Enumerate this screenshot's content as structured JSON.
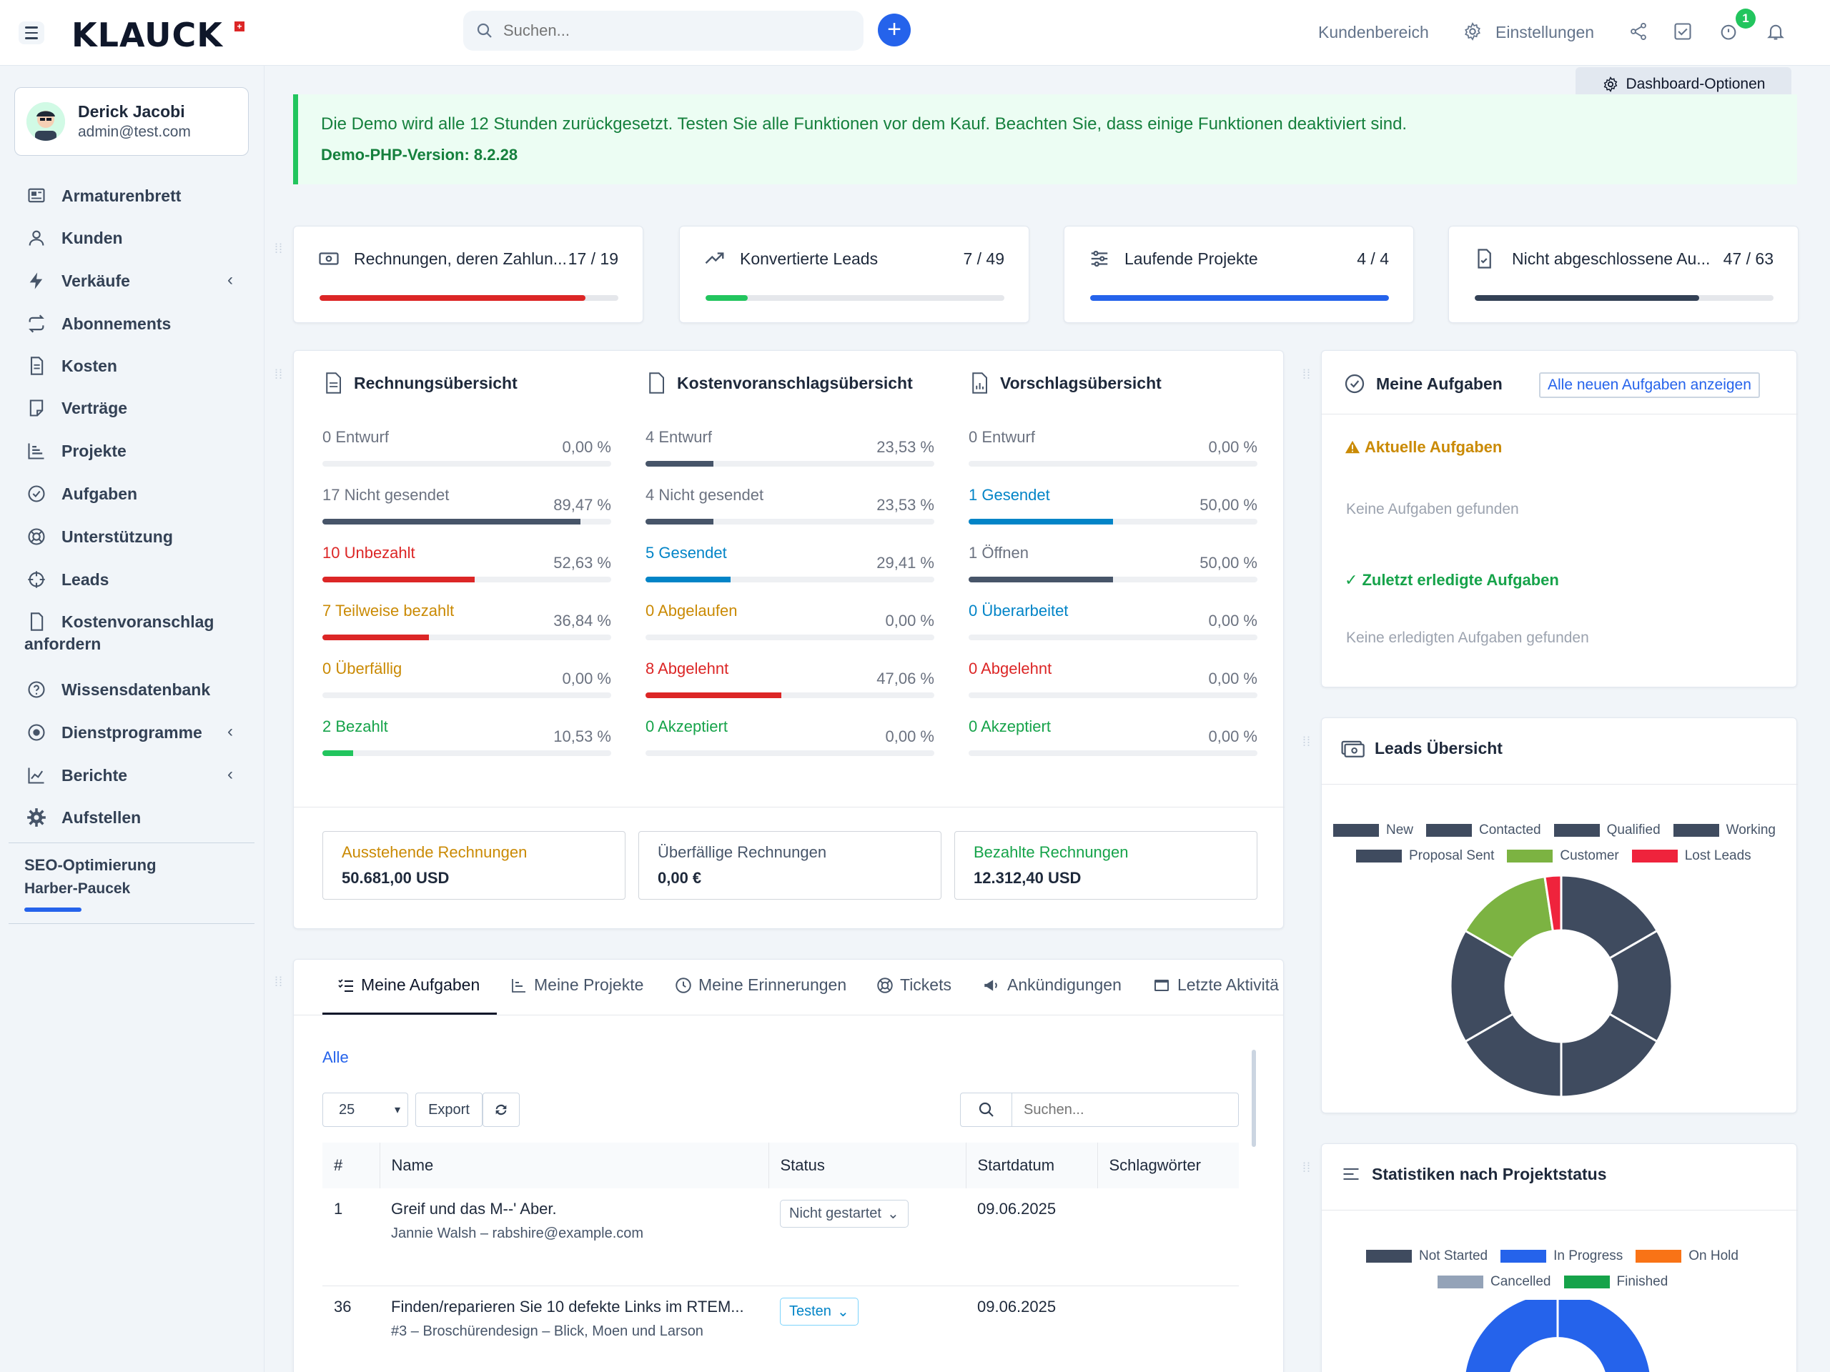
{
  "header": {
    "logo": "KLAUCK",
    "search_placeholder": "Suchen...",
    "kundenbereich": "Kundenbereich",
    "einstellungen": "Einstellungen",
    "notification_count": "1"
  },
  "user": {
    "name": "Derick Jacobi",
    "email": "admin@test.com"
  },
  "sidebar": {
    "items": [
      {
        "label": "Armaturenbrett"
      },
      {
        "label": "Kunden"
      },
      {
        "label": "Verkäufe"
      },
      {
        "label": "Abonnements"
      },
      {
        "label": "Kosten"
      },
      {
        "label": "Verträge"
      },
      {
        "label": "Projekte"
      },
      {
        "label": "Aufgaben"
      },
      {
        "label": "Unterstützung"
      },
      {
        "label": "Leads"
      },
      {
        "label": "Kostenvoranschlag"
      },
      {
        "label": "Wissensdatenbank"
      },
      {
        "label": "Dienstprogramme"
      },
      {
        "label": "Berichte"
      },
      {
        "label": "Aufstellen"
      }
    ],
    "kv_line2": "anfordern",
    "seo_title": "SEO-Optimierung",
    "seo_client": "Harber-Paucek"
  },
  "dashboard_options": "Dashboard-Optionen",
  "alert": {
    "message": "Die Demo wird alle 12 Stunden zurückgesetzt. Testen Sie alle Funktionen vor dem Kauf. Beachten Sie, dass einige Funktionen deaktiviert sind.",
    "php": "Demo-PHP-Version: 8.2.28"
  },
  "stats": [
    {
      "label": "Rechnungen, deren Zahlun...",
      "value": "17 / 19",
      "progress": 0.89,
      "color": "#dc2626"
    },
    {
      "label": "Konvertierte Leads",
      "value": "7 / 49",
      "progress": 0.14,
      "color": "#22c55e"
    },
    {
      "label": "Laufende Projekte",
      "value": "4 / 4",
      "progress": 1.0,
      "color": "#2563eb"
    },
    {
      "label": "Nicht abgeschlossene Au...",
      "value": "47 / 63",
      "progress": 0.75,
      "color": "#334155"
    }
  ],
  "overview": {
    "invoice": {
      "title": "Rechnungsübersicht",
      "rows": [
        {
          "label": "0 Entwurf",
          "pct": "0,00 %",
          "value": 0,
          "color": "#6b7280",
          "bar": "#475569"
        },
        {
          "label": "17 Nicht gesendet",
          "pct": "89,47 %",
          "value": 89.47,
          "color": "#6b7280",
          "bar": "#475569"
        },
        {
          "label": "10 Unbezahlt",
          "pct": "52,63 %",
          "value": 52.63,
          "color": "#dc2626",
          "bar": "#dc2626"
        },
        {
          "label": "7 Teilweise bezahlt",
          "pct": "36,84 %",
          "value": 36.84,
          "color": "#ca8a04",
          "bar": "#dc2626"
        },
        {
          "label": "0 Überfällig",
          "pct": "0,00 %",
          "value": 0,
          "color": "#ca8a04",
          "bar": "#ca8a04"
        },
        {
          "label": "2 Bezahlt",
          "pct": "10,53 %",
          "value": 10.53,
          "color": "#16a34a",
          "bar": "#22c55e"
        }
      ]
    },
    "estimate": {
      "title": "Kostenvoranschlagsübersicht",
      "rows": [
        {
          "label": "4 Entwurf",
          "pct": "23,53 %",
          "value": 23.53,
          "color": "#6b7280",
          "bar": "#475569"
        },
        {
          "label": "4 Nicht gesendet",
          "pct": "23,53 %",
          "value": 23.53,
          "color": "#6b7280",
          "bar": "#475569"
        },
        {
          "label": "5 Gesendet",
          "pct": "29,41 %",
          "value": 29.41,
          "color": "#0284c7",
          "bar": "#0284c7"
        },
        {
          "label": "0 Abgelaufen",
          "pct": "0,00 %",
          "value": 0,
          "color": "#ca8a04",
          "bar": "#ca8a04"
        },
        {
          "label": "8 Abgelehnt",
          "pct": "47,06 %",
          "value": 47.06,
          "color": "#dc2626",
          "bar": "#dc2626"
        },
        {
          "label": "0 Akzeptiert",
          "pct": "0,00 %",
          "value": 0,
          "color": "#16a34a",
          "bar": "#22c55e"
        }
      ]
    },
    "proposal": {
      "title": "Vorschlagsübersicht",
      "rows": [
        {
          "label": "0 Entwurf",
          "pct": "0,00 %",
          "value": 0,
          "color": "#6b7280",
          "bar": "#475569"
        },
        {
          "label": "1 Gesendet",
          "pct": "50,00 %",
          "value": 50,
          "color": "#0284c7",
          "bar": "#0284c7"
        },
        {
          "label": "1 Öffnen",
          "pct": "50,00 %",
          "value": 50,
          "color": "#6b7280",
          "bar": "#475569"
        },
        {
          "label": "0 Überarbeitet",
          "pct": "0,00 %",
          "value": 0,
          "color": "#0284c7",
          "bar": "#0284c7"
        },
        {
          "label": "0 Abgelehnt",
          "pct": "0,00 %",
          "value": 0,
          "color": "#dc2626",
          "bar": "#dc2626"
        },
        {
          "label": "0 Akzeptiert",
          "pct": "0,00 %",
          "value": 0,
          "color": "#16a34a",
          "bar": "#22c55e"
        }
      ]
    }
  },
  "summary": [
    {
      "label": "Ausstehende Rechnungen",
      "value": "50.681,00 USD",
      "color": "#ca8a04"
    },
    {
      "label": "Überfällige Rechnungen",
      "value": "0,00 €",
      "color": "#475569"
    },
    {
      "label": "Bezahlte Rechnungen",
      "value": "12.312,40 USD",
      "color": "#16a34a"
    }
  ],
  "tasks_panel": {
    "title": "Meine Aufgaben",
    "link": "Alle neuen Aufgaben anzeigen",
    "current": "Aktuelle Aufgaben",
    "none_current": "Keine Aufgaben gefunden",
    "done": "Zuletzt erledigte Aufgaben",
    "none_done": "Keine erledigten Aufgaben gefunden"
  },
  "tabs": [
    "Meine Aufgaben",
    "Meine Projekte",
    "Meine Erinnerungen",
    "Tickets",
    "Ankündigungen",
    "Letzte Aktivitä"
  ],
  "table": {
    "filter_all": "Alle",
    "page_size": "25",
    "export": "Export",
    "search_placeholder": "Suchen...",
    "headers": [
      "#",
      "Name",
      "Status",
      "Startdatum",
      "Schlagwörter"
    ],
    "rows": [
      {
        "id": "1",
        "name": "Greif und das M--' Aber.",
        "sub": "Jannie Walsh – rabshire@example.com",
        "status": "Nicht gestartet",
        "start": "09.06.2025"
      },
      {
        "id": "36",
        "name": "Finden/reparieren Sie 10 defekte Links im RTEM...",
        "sub": "#3 – Broschürendesign – Blick, Moen und Larson",
        "status": "Testen",
        "start": "09.06.2025"
      }
    ]
  },
  "leads_chart": {
    "title": "Leads Übersicht",
    "chart_data": {
      "type": "pie",
      "variant": "doughnut",
      "legend": [
        "New",
        "Contacted",
        "Qualified",
        "Working",
        "Proposal Sent",
        "Customer",
        "Lost Leads"
      ],
      "colors": [
        "#3f4b5f",
        "#3f4b5f",
        "#3f4b5f",
        "#3f4b5f",
        "#3f4b5f",
        "#7cb342",
        "#ef233c"
      ],
      "values": [
        7,
        7,
        7,
        7,
        7,
        6,
        1
      ]
    }
  },
  "project_chart": {
    "title": "Statistiken nach Projektstatus",
    "chart_data": {
      "type": "pie",
      "variant": "doughnut",
      "legend": [
        "Not Started",
        "In Progress",
        "On Hold",
        "Cancelled",
        "Finished"
      ],
      "colors": [
        "#3f4b5f",
        "#2563eb",
        "#f97316",
        "#94a3b8",
        "#16a34a"
      ]
    }
  }
}
